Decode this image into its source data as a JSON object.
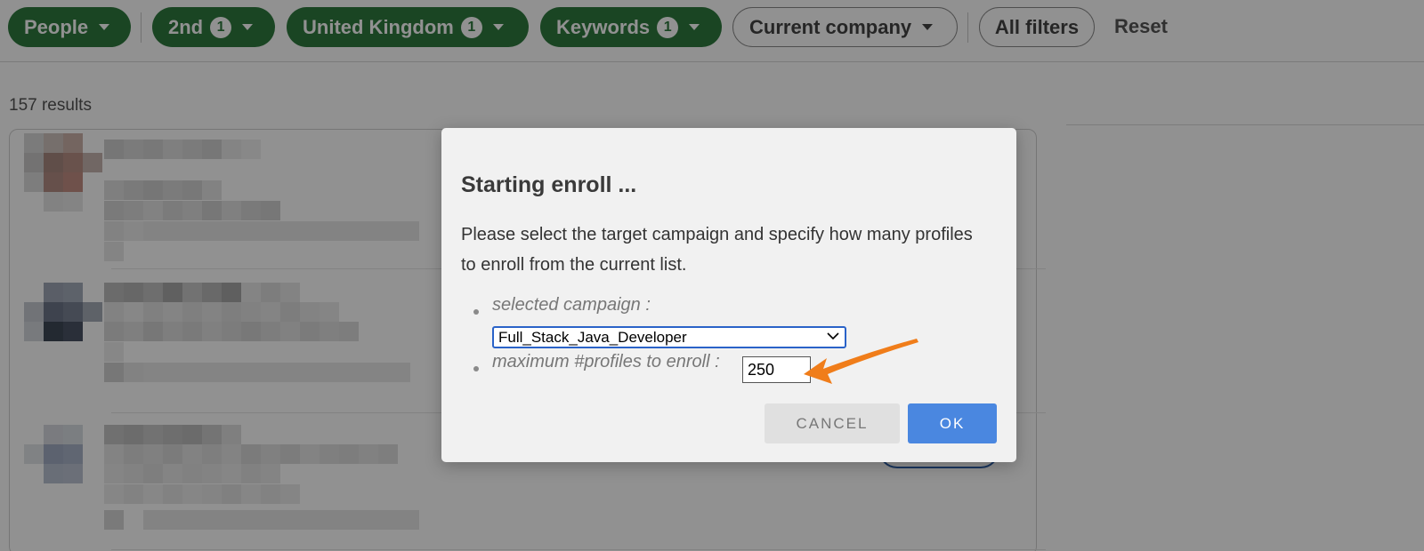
{
  "filters": [
    {
      "label": "People",
      "badge": "",
      "style": "green"
    },
    {
      "label": "2nd",
      "badge": "1",
      "style": "green"
    },
    {
      "label": "United Kingdom",
      "badge": "1",
      "style": "green"
    },
    {
      "label": "Keywords",
      "badge": "1",
      "style": "green"
    },
    {
      "label": "Current company",
      "badge": "",
      "style": "outline"
    },
    {
      "label": "All filters",
      "badge": "",
      "style": "outline"
    }
  ],
  "reset_label": "Reset",
  "results_count": "157 results",
  "dialog": {
    "title": "Starting enroll ...",
    "message": "Please select the target campaign and specify how many profiles to enroll from the current list.",
    "campaign_label": "selected campaign :",
    "campaign_value": "Full_Stack_Java_Developer",
    "max_label": "maximum #profiles to enroll :",
    "max_value": "250",
    "cancel_label": "CANCEL",
    "ok_label": "OK"
  },
  "colors": {
    "filter_green": "#2f7a3e",
    "ok_blue": "#4a87e0",
    "arrow_orange": "#f07d1a"
  },
  "icons": [
    "chevron-down-icon",
    "arrow-pointer-icon"
  ]
}
